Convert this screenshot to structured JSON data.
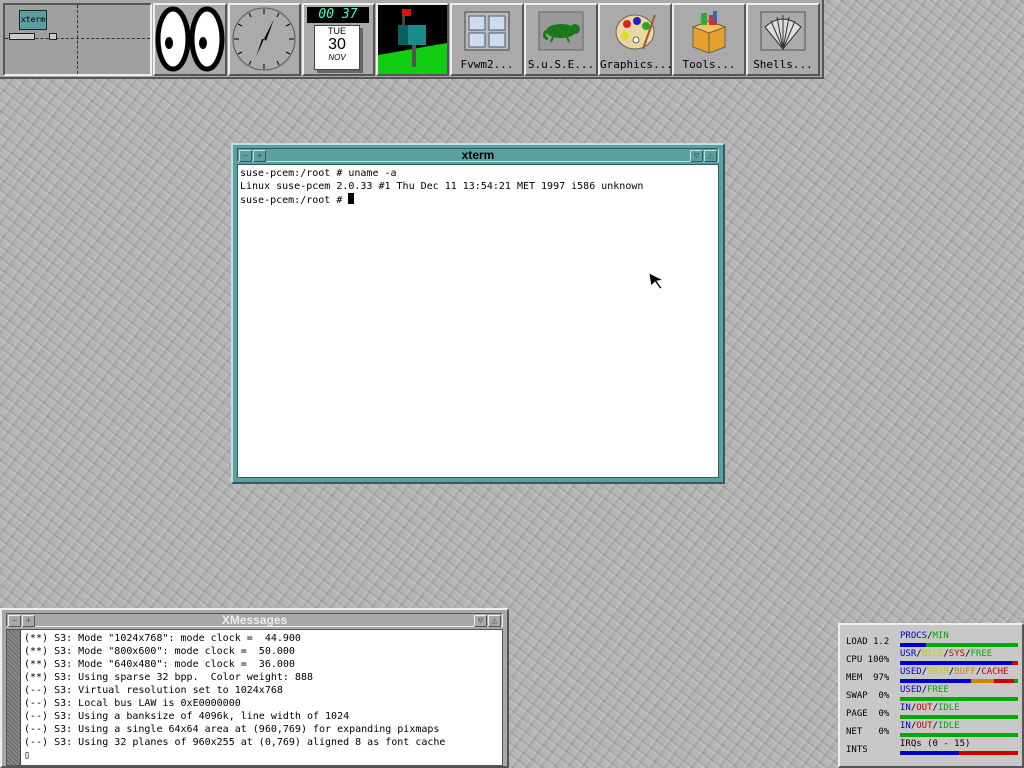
{
  "colors": {
    "xterm_frame": "#5c9fa0",
    "frame_light": "#b9e3e3",
    "frame_dark": "#2d5f60",
    "panel_gray": "#aaaaaa",
    "meter_green": "#00aa00",
    "meter_blue": "#0000cc",
    "meter_red": "#cc0000",
    "meter_yellow": "#cccc00",
    "meter_orange": "#cc8800"
  },
  "taskbar": {
    "pager": {
      "window_label": "xterm"
    },
    "clock_digital": "00 37",
    "calendar": {
      "weekday": "TUE",
      "day": "30",
      "month": "NOV"
    },
    "icons": {
      "xeyes": "eyes-icon",
      "clock": "analog-clock-icon",
      "mailbox": "mailbox-icon"
    },
    "folders": [
      {
        "label": "Fvwm2...",
        "icon": "window-icon"
      },
      {
        "label": "S.u.S.E...",
        "icon": "chameleon-icon"
      },
      {
        "label": "Graphics...",
        "icon": "palette-icon"
      },
      {
        "label": "Tools...",
        "icon": "toolbox-icon"
      },
      {
        "label": "Shells...",
        "icon": "shell-icon"
      }
    ]
  },
  "xterm": {
    "title": "xterm",
    "lines": [
      "suse-pcem:/root # uname -a",
      "Linux suse-pcem 2.0.33 #1 Thu Dec 11 13:54:21 MET 1997 i586 unknown",
      "suse-pcem:/root # "
    ]
  },
  "xmessages": {
    "title": "XMessages",
    "lines": [
      "(**) S3: Mode \"1024x768\": mode clock =  44.900",
      "(**) S3: Mode \"800x600\": mode clock =  50.000",
      "(**) S3: Mode \"640x480\": mode clock =  36.000",
      "(**) S3: Using sparse 32 bpp.  Color weight: 888",
      "(--) S3: Virtual resolution set to 1024x768",
      "(--) S3: Local bus LAW is 0xE0000000",
      "(--) S3: Using a banksize of 4096k, line width of 1024",
      "(--) S3: Using a single 64x64 area at (960,769) for expanding pixmaps",
      "(--) S3: Using 32 planes of 960x255 at (0,769) aligned 8 as font cache",
      "▯"
    ]
  },
  "xosview": {
    "rows": [
      {
        "label": "LOAD 1.2",
        "legend": [
          {
            "t": "PROCS",
            "c": "#0000cc"
          },
          {
            "t": "/",
            "c": "#000"
          },
          {
            "t": "MIN",
            "c": "#00aa00"
          }
        ],
        "segments": [
          {
            "c": "#0000cc",
            "f": 0.22
          },
          {
            "c": "#00aa00",
            "f": 0.78
          }
        ]
      },
      {
        "label": "CPU 100%",
        "legend": [
          {
            "t": "USR",
            "c": "#0000cc"
          },
          {
            "t": "/",
            "c": "#000"
          },
          {
            "t": "NICE",
            "c": "#cccc00"
          },
          {
            "t": "/",
            "c": "#000"
          },
          {
            "t": "SYS",
            "c": "#cc0000"
          },
          {
            "t": "/",
            "c": "#000"
          },
          {
            "t": "FREE",
            "c": "#00aa00"
          }
        ],
        "segments": [
          {
            "c": "#0000cc",
            "f": 0.95
          },
          {
            "c": "#cc0000",
            "f": 0.05
          }
        ]
      },
      {
        "label": "MEM  97%",
        "legend": [
          {
            "t": "USED",
            "c": "#0000cc"
          },
          {
            "t": "/",
            "c": "#000"
          },
          {
            "t": "SHAR",
            "c": "#cccc00"
          },
          {
            "t": "/",
            "c": "#000"
          },
          {
            "t": "BUFF",
            "c": "#cc8800"
          },
          {
            "t": "/",
            "c": "#000"
          },
          {
            "t": "CACHE",
            "c": "#cc0000"
          }
        ],
        "segments": [
          {
            "c": "#0000cc",
            "f": 0.6
          },
          {
            "c": "#cc8800",
            "f": 0.2
          },
          {
            "c": "#cc0000",
            "f": 0.17
          },
          {
            "c": "#00aa00",
            "f": 0.03
          }
        ]
      },
      {
        "label": "SWAP  0%",
        "legend": [
          {
            "t": "USED",
            "c": "#0000cc"
          },
          {
            "t": "/",
            "c": "#000"
          },
          {
            "t": "FREE",
            "c": "#00aa00"
          }
        ],
        "segments": [
          {
            "c": "#00aa00",
            "f": 1
          }
        ]
      },
      {
        "label": "PAGE  0%",
        "legend": [
          {
            "t": "IN",
            "c": "#0000cc"
          },
          {
            "t": "/",
            "c": "#000"
          },
          {
            "t": "OUT",
            "c": "#cc0000"
          },
          {
            "t": "/",
            "c": "#000"
          },
          {
            "t": "IDLE",
            "c": "#00aa00"
          }
        ],
        "segments": [
          {
            "c": "#00aa00",
            "f": 1
          }
        ]
      },
      {
        "label": "NET   0%",
        "legend": [
          {
            "t": "IN",
            "c": "#0000cc"
          },
          {
            "t": "/",
            "c": "#000"
          },
          {
            "t": "OUT",
            "c": "#cc0000"
          },
          {
            "t": "/",
            "c": "#000"
          },
          {
            "t": "IDLE",
            "c": "#00aa00"
          }
        ],
        "segments": [
          {
            "c": "#00aa00",
            "f": 1
          }
        ]
      },
      {
        "label": "INTS",
        "legend": [
          {
            "t": "IRQs (0 - 15)",
            "c": "#000"
          }
        ],
        "segments": [
          {
            "c": "#0000cc",
            "f": 0.5
          },
          {
            "c": "#cc0000",
            "f": 0.5
          }
        ]
      }
    ]
  }
}
